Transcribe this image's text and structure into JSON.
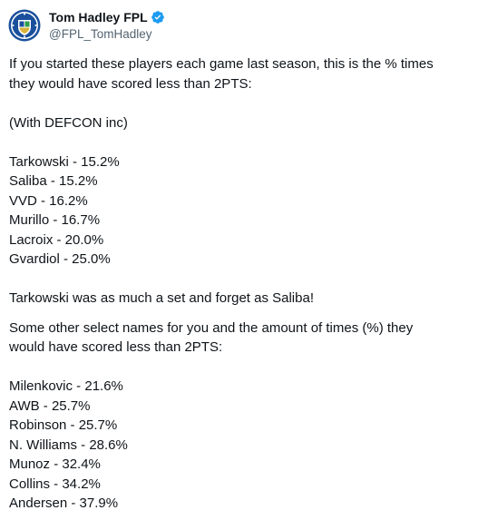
{
  "author": {
    "display_name": "Tom Hadley FPL",
    "handle": "@FPL_TomHadley",
    "avatar_icon": "club-crest-icon",
    "verified_icon": "verified-badge-icon",
    "verified_color": "#1d9bf0"
  },
  "tweet": {
    "intro_line_1": "If you started these players each game last season, this is the % times",
    "intro_line_2": "they would have scored less than 2PTS:",
    "note": "(With DEFCON inc)",
    "list_one": [
      "Tarkowski - 15.2%",
      "Saliba - 15.2%",
      "VVD - 16.2%",
      "Murillo - 16.7%",
      "Lacroix - 20.0%",
      "Gvardiol - 25.0%"
    ],
    "comment": "Tarkowski was as much a set and forget as Saliba!",
    "other_line_1": "Some other select names for you and the amount of times (%) they",
    "other_line_2": "would have scored less than 2PTS:",
    "list_two": [
      "Milenkovic - 21.6%",
      "AWB - 25.7%",
      "Robinson - 25.7%",
      "N. Williams - 28.6%",
      "Munoz - 32.4%",
      "Collins - 34.2%",
      "Andersen - 37.9%"
    ]
  }
}
